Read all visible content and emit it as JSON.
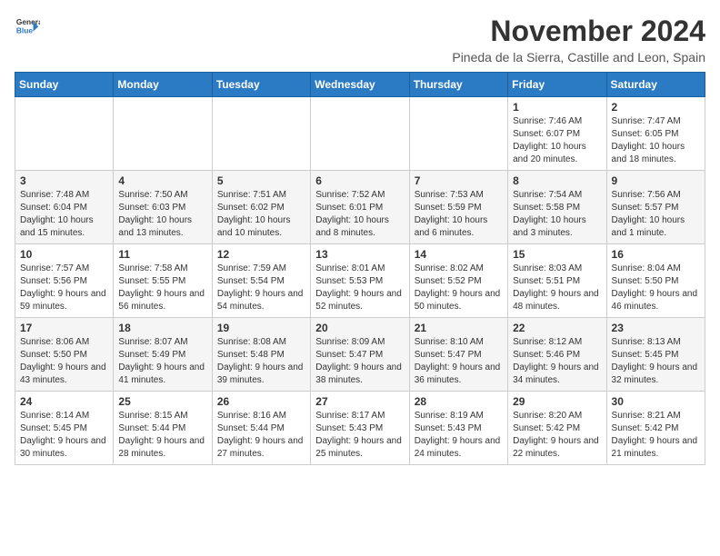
{
  "header": {
    "logo_general": "General",
    "logo_blue": "Blue",
    "month_title": "November 2024",
    "subtitle": "Pineda de la Sierra, Castille and Leon, Spain"
  },
  "weekdays": [
    "Sunday",
    "Monday",
    "Tuesday",
    "Wednesday",
    "Thursday",
    "Friday",
    "Saturday"
  ],
  "weeks": [
    [
      {
        "day": "",
        "info": ""
      },
      {
        "day": "",
        "info": ""
      },
      {
        "day": "",
        "info": ""
      },
      {
        "day": "",
        "info": ""
      },
      {
        "day": "",
        "info": ""
      },
      {
        "day": "1",
        "info": "Sunrise: 7:46 AM\nSunset: 6:07 PM\nDaylight: 10 hours and 20 minutes."
      },
      {
        "day": "2",
        "info": "Sunrise: 7:47 AM\nSunset: 6:05 PM\nDaylight: 10 hours and 18 minutes."
      }
    ],
    [
      {
        "day": "3",
        "info": "Sunrise: 7:48 AM\nSunset: 6:04 PM\nDaylight: 10 hours and 15 minutes."
      },
      {
        "day": "4",
        "info": "Sunrise: 7:50 AM\nSunset: 6:03 PM\nDaylight: 10 hours and 13 minutes."
      },
      {
        "day": "5",
        "info": "Sunrise: 7:51 AM\nSunset: 6:02 PM\nDaylight: 10 hours and 10 minutes."
      },
      {
        "day": "6",
        "info": "Sunrise: 7:52 AM\nSunset: 6:01 PM\nDaylight: 10 hours and 8 minutes."
      },
      {
        "day": "7",
        "info": "Sunrise: 7:53 AM\nSunset: 5:59 PM\nDaylight: 10 hours and 6 minutes."
      },
      {
        "day": "8",
        "info": "Sunrise: 7:54 AM\nSunset: 5:58 PM\nDaylight: 10 hours and 3 minutes."
      },
      {
        "day": "9",
        "info": "Sunrise: 7:56 AM\nSunset: 5:57 PM\nDaylight: 10 hours and 1 minute."
      }
    ],
    [
      {
        "day": "10",
        "info": "Sunrise: 7:57 AM\nSunset: 5:56 PM\nDaylight: 9 hours and 59 minutes."
      },
      {
        "day": "11",
        "info": "Sunrise: 7:58 AM\nSunset: 5:55 PM\nDaylight: 9 hours and 56 minutes."
      },
      {
        "day": "12",
        "info": "Sunrise: 7:59 AM\nSunset: 5:54 PM\nDaylight: 9 hours and 54 minutes."
      },
      {
        "day": "13",
        "info": "Sunrise: 8:01 AM\nSunset: 5:53 PM\nDaylight: 9 hours and 52 minutes."
      },
      {
        "day": "14",
        "info": "Sunrise: 8:02 AM\nSunset: 5:52 PM\nDaylight: 9 hours and 50 minutes."
      },
      {
        "day": "15",
        "info": "Sunrise: 8:03 AM\nSunset: 5:51 PM\nDaylight: 9 hours and 48 minutes."
      },
      {
        "day": "16",
        "info": "Sunrise: 8:04 AM\nSunset: 5:50 PM\nDaylight: 9 hours and 46 minutes."
      }
    ],
    [
      {
        "day": "17",
        "info": "Sunrise: 8:06 AM\nSunset: 5:50 PM\nDaylight: 9 hours and 43 minutes."
      },
      {
        "day": "18",
        "info": "Sunrise: 8:07 AM\nSunset: 5:49 PM\nDaylight: 9 hours and 41 minutes."
      },
      {
        "day": "19",
        "info": "Sunrise: 8:08 AM\nSunset: 5:48 PM\nDaylight: 9 hours and 39 minutes."
      },
      {
        "day": "20",
        "info": "Sunrise: 8:09 AM\nSunset: 5:47 PM\nDaylight: 9 hours and 38 minutes."
      },
      {
        "day": "21",
        "info": "Sunrise: 8:10 AM\nSunset: 5:47 PM\nDaylight: 9 hours and 36 minutes."
      },
      {
        "day": "22",
        "info": "Sunrise: 8:12 AM\nSunset: 5:46 PM\nDaylight: 9 hours and 34 minutes."
      },
      {
        "day": "23",
        "info": "Sunrise: 8:13 AM\nSunset: 5:45 PM\nDaylight: 9 hours and 32 minutes."
      }
    ],
    [
      {
        "day": "24",
        "info": "Sunrise: 8:14 AM\nSunset: 5:45 PM\nDaylight: 9 hours and 30 minutes."
      },
      {
        "day": "25",
        "info": "Sunrise: 8:15 AM\nSunset: 5:44 PM\nDaylight: 9 hours and 28 minutes."
      },
      {
        "day": "26",
        "info": "Sunrise: 8:16 AM\nSunset: 5:44 PM\nDaylight: 9 hours and 27 minutes."
      },
      {
        "day": "27",
        "info": "Sunrise: 8:17 AM\nSunset: 5:43 PM\nDaylight: 9 hours and 25 minutes."
      },
      {
        "day": "28",
        "info": "Sunrise: 8:19 AM\nSunset: 5:43 PM\nDaylight: 9 hours and 24 minutes."
      },
      {
        "day": "29",
        "info": "Sunrise: 8:20 AM\nSunset: 5:42 PM\nDaylight: 9 hours and 22 minutes."
      },
      {
        "day": "30",
        "info": "Sunrise: 8:21 AM\nSunset: 5:42 PM\nDaylight: 9 hours and 21 minutes."
      }
    ]
  ]
}
